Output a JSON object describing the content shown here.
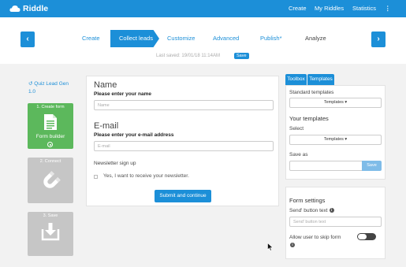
{
  "topbar": {
    "brand": "Riddle",
    "menu": [
      "Create",
      "My Riddles",
      "Statistics"
    ],
    "more_icon": "kebab-menu-icon"
  },
  "steps": {
    "items": [
      "Create",
      "Collect leads",
      "Customize",
      "Advanced",
      "Publish*",
      "Analyze"
    ],
    "active": "Collect leads",
    "last_saved": "Last saved: 19/01/18 11:14AM",
    "save_badge": "Save"
  },
  "sidebar": {
    "quiz_title": "Quiz Lead Gen 1.0",
    "cards": [
      {
        "caption": "1. Create form",
        "sub": "Form builder",
        "icon": "form-document-icon"
      },
      {
        "caption": "2. Connect",
        "icon": "magnet-icon"
      },
      {
        "caption": "3. Save",
        "icon": "download-box-icon"
      }
    ]
  },
  "form": {
    "name_heading": "Name",
    "name_label": "Please enter your name",
    "name_placeholder": "Name",
    "email_heading": "E-mail",
    "email_label": "Please enter your e-mail address",
    "email_placeholder": "E-mail",
    "newsletter_label": "Newsletter sign up",
    "newsletter_option": "Yes, I want to receive your newsletter.",
    "submit_label": "Submit and continue"
  },
  "right": {
    "tabs": [
      "Toolbox",
      "Templates"
    ],
    "standard_templates": "Standard templates",
    "templates_dropdown": "Templates ▾",
    "your_templates": "Your templates",
    "select_label": "Select",
    "select_dropdown": "Templates ▾",
    "save_as_label": "Save as",
    "save_button": "Save",
    "form_settings": "Form settings",
    "send_button_text_label": "Send' button text",
    "send_button_placeholder": "Send' button text",
    "skip_form_label": "Allow user to skip form"
  },
  "colors": {
    "accent": "#1c8fd8",
    "success": "#5cb85c",
    "disabled": "#c6c6c6"
  }
}
